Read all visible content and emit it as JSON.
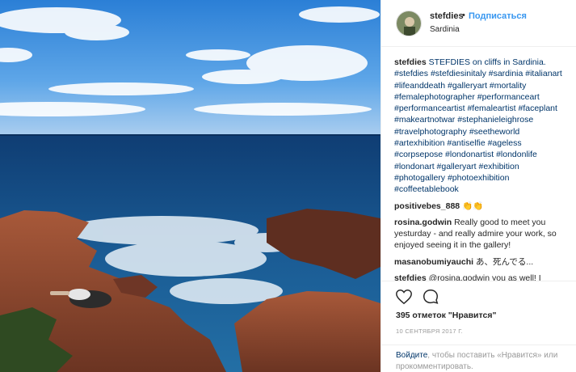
{
  "post": {
    "username": "stefdies",
    "separator": "•",
    "follow_label": "Подписаться",
    "location": "Sardinia"
  },
  "photo": {
    "description_icon": "photo-icon"
  },
  "comments": [
    {
      "user": "stefdies",
      "text": "STEFDIES on cliffs in Sardinia. #stefdies #stefdiesinitaly #sardinia #italianart #lifeanddeath #galleryart #mortality #femalephotographer #performanceart #performanceartist #femaleartist #faceplant #makeartnotwar #stephanieleighrose #travelphotography #seetheworld #artexhibition #antiselfie #ageless #corpsepose #londonartist #londonlife #londonart #galleryart #exhibition #photogallery #photoexhibition #coffeetablebook"
    },
    {
      "user": "positivebes_888",
      "text": "👏👏"
    },
    {
      "user": "rosina.godwin",
      "text": "Really good to meet you yesturday - and really admire your work, so enjoyed seeing it in the gallery!"
    },
    {
      "user": "masanobumiyauchi",
      "text": "あ、死んでる..."
    },
    {
      "user": "stefdies",
      "text": "@rosina.godwin you as well! I"
    }
  ],
  "actions": {
    "likes_text": "395 отметок \"Нравится\"",
    "date_text": "10 СЕНТЯБРЯ 2017 Г.",
    "login_link": "Войдите",
    "login_rest": ", чтобы поставить «Нравится» или прокомментировать."
  }
}
